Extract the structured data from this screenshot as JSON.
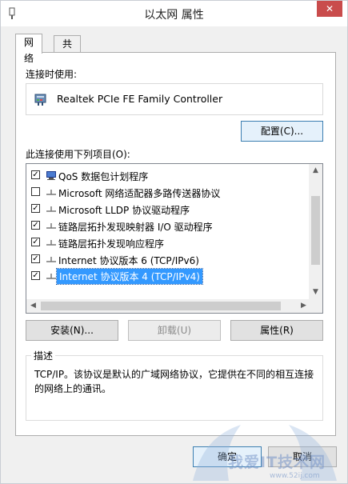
{
  "window": {
    "title": "以太网 属性",
    "close_label": "✕"
  },
  "tabs": [
    {
      "label": "网络",
      "active": true
    },
    {
      "label": "共享",
      "active": false
    }
  ],
  "connect_using": {
    "label": "连接时使用:",
    "adapter": "Realtek PCIe FE Family Controller",
    "configure_button": "配置(C)..."
  },
  "items_section": {
    "label": "此连接使用下列项目(O):",
    "items": [
      {
        "label": "QoS 数据包计划程序",
        "checked": true,
        "icon": "qos-scheduler-icon",
        "selected": false
      },
      {
        "label": "Microsoft 网络适配器多路传送器协议",
        "checked": false,
        "icon": "protocol-icon",
        "selected": false
      },
      {
        "label": "Microsoft LLDP 协议驱动程序",
        "checked": true,
        "icon": "protocol-icon",
        "selected": false
      },
      {
        "label": "链路层拓扑发现映射器 I/O 驱动程序",
        "checked": true,
        "icon": "protocol-icon",
        "selected": false
      },
      {
        "label": "链路层拓扑发现响应程序",
        "checked": true,
        "icon": "protocol-icon",
        "selected": false
      },
      {
        "label": "Internet 协议版本 6 (TCP/IPv6)",
        "checked": true,
        "icon": "protocol-icon",
        "selected": false
      },
      {
        "label": "Internet 协议版本 4 (TCP/IPv4)",
        "checked": true,
        "icon": "protocol-icon",
        "selected": true
      }
    ]
  },
  "buttons": {
    "install": "安装(N)...",
    "uninstall": "卸载(U)",
    "properties": "属性(R)",
    "ok": "确定",
    "cancel": "取消"
  },
  "description": {
    "title": "描述",
    "text": "TCP/IP。该协议是默认的广域网络协议，它提供在不同的相互连接的网络上的通讯。"
  },
  "watermark": {
    "text": "我爱IT技术网",
    "url": "www.52ij.com"
  },
  "colors": {
    "selection": "#3399ff",
    "close": "#c94c4c",
    "window_bg": "#f0f0f0"
  }
}
